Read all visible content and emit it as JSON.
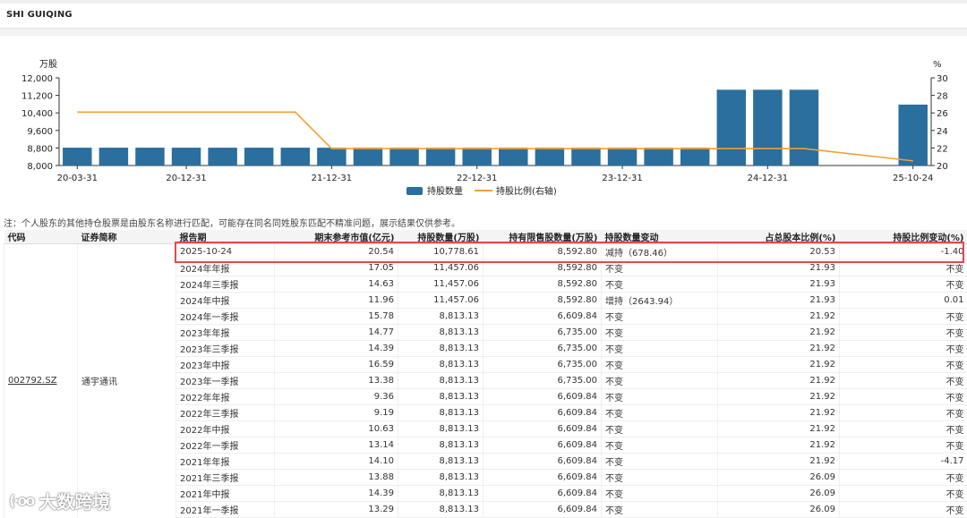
{
  "header": {
    "title": "SHI GUIQING"
  },
  "note": "注：个人股东的其他持仓股票是由股东名称进行匹配，可能存在同名同姓股东匹配不精准问题，展示结果仅供参考。",
  "chart_data": {
    "type": "bar",
    "left_axis_unit": "万股",
    "right_axis_unit": "%",
    "left_ylim": [
      8000,
      12000
    ],
    "left_ticks": [
      "12,000",
      "11,200",
      "10,400",
      "9,600",
      "8,800",
      "8,000"
    ],
    "right_ylim": [
      20,
      30
    ],
    "right_ticks": [
      "30",
      "28",
      "26",
      "24",
      "22",
      "20"
    ],
    "x_tick_labels": [
      "20-03-31",
      "20-12-31",
      "21-12-31",
      "22-12-31",
      "23-12-31",
      "24-12-31",
      "25-10-24"
    ],
    "x_tick_index": [
      0,
      3,
      7,
      11,
      15,
      19,
      23
    ],
    "legend_placement": "bottom-center",
    "colors": {
      "bar": "#2a6f9e",
      "line": "#f0a030"
    },
    "series": [
      {
        "name": "持股数量",
        "kind": "bar",
        "values": [
          8813.13,
          8813.13,
          8813.13,
          8813.13,
          8813.13,
          8813.13,
          8813.13,
          8813.13,
          8813.13,
          8813.13,
          8813.13,
          8813.13,
          8813.13,
          8813.13,
          8813.13,
          8813.13,
          8813.13,
          8813.13,
          11457.06,
          11457.06,
          11457.06,
          null,
          null,
          10778.61
        ]
      },
      {
        "name": "持股比例(右轴)",
        "kind": "line",
        "values": [
          26.09,
          26.09,
          26.09,
          26.09,
          26.09,
          26.09,
          26.09,
          21.92,
          21.92,
          21.92,
          21.92,
          21.92,
          21.92,
          21.92,
          21.92,
          21.92,
          21.92,
          21.92,
          21.93,
          21.93,
          21.93,
          null,
          null,
          20.53
        ]
      }
    ]
  },
  "table": {
    "headers": [
      "代码",
      "证券简称",
      "报告期",
      "期末参考市值(亿元)",
      "持股数量(万股)",
      "持有限售股数量(万股)",
      "持股数量变动",
      "占总股本比例(%)",
      "持股比例变动(%)"
    ],
    "code": "002792.SZ",
    "name": "通宇通讯",
    "rows": [
      [
        "2025-10-24",
        "20.54",
        "10,778.61",
        "8,592.80",
        "减持（678.46）",
        "20.53",
        "-1.40"
      ],
      [
        "2024年年报",
        "17.05",
        "11,457.06",
        "8,592.80",
        "不变",
        "21.93",
        "不变"
      ],
      [
        "2024年三季报",
        "14.63",
        "11,457.06",
        "8,592.80",
        "不变",
        "21.93",
        "不变"
      ],
      [
        "2024年中报",
        "11.96",
        "11,457.06",
        "8,592.80",
        "增持（2643.94）",
        "21.93",
        "0.01"
      ],
      [
        "2024年一季报",
        "15.78",
        "8,813.13",
        "6,609.84",
        "不变",
        "21.92",
        "不变"
      ],
      [
        "2023年年报",
        "14.77",
        "8,813.13",
        "6,735.00",
        "不变",
        "21.92",
        "不变"
      ],
      [
        "2023年三季报",
        "14.39",
        "8,813.13",
        "6,735.00",
        "不变",
        "21.92",
        "不变"
      ],
      [
        "2023年中报",
        "16.59",
        "8,813.13",
        "6,735.00",
        "不变",
        "21.92",
        "不变"
      ],
      [
        "2023年一季报",
        "13.38",
        "8,813.13",
        "6,735.00",
        "不变",
        "21.92",
        "不变"
      ],
      [
        "2022年年报",
        "9.36",
        "8,813.13",
        "6,609.84",
        "不变",
        "21.92",
        "不变"
      ],
      [
        "2022年三季报",
        "9.19",
        "8,813.13",
        "6,609.84",
        "不变",
        "21.92",
        "不变"
      ],
      [
        "2022年中报",
        "10.63",
        "8,813.13",
        "6,609.84",
        "不变",
        "21.92",
        "不变"
      ],
      [
        "2022年一季报",
        "13.14",
        "8,813.13",
        "6,609.84",
        "不变",
        "21.92",
        "不变"
      ],
      [
        "2021年年报",
        "14.10",
        "8,813.13",
        "6,609.84",
        "不变",
        "21.92",
        "-4.17"
      ],
      [
        "2021年三季报",
        "13.88",
        "8,813.13",
        "6,609.84",
        "不变",
        "26.09",
        "不变"
      ],
      [
        "2021年中报",
        "14.39",
        "8,813.13",
        "6,609.84",
        "不变",
        "26.09",
        "不变"
      ],
      [
        "2021年一季报",
        "13.29",
        "8,813.13",
        "6,609.84",
        "不变",
        "26.09",
        "不变"
      ]
    ]
  },
  "watermark": {
    "text": "大数跨境",
    "icon": "eye-logo-icon"
  }
}
